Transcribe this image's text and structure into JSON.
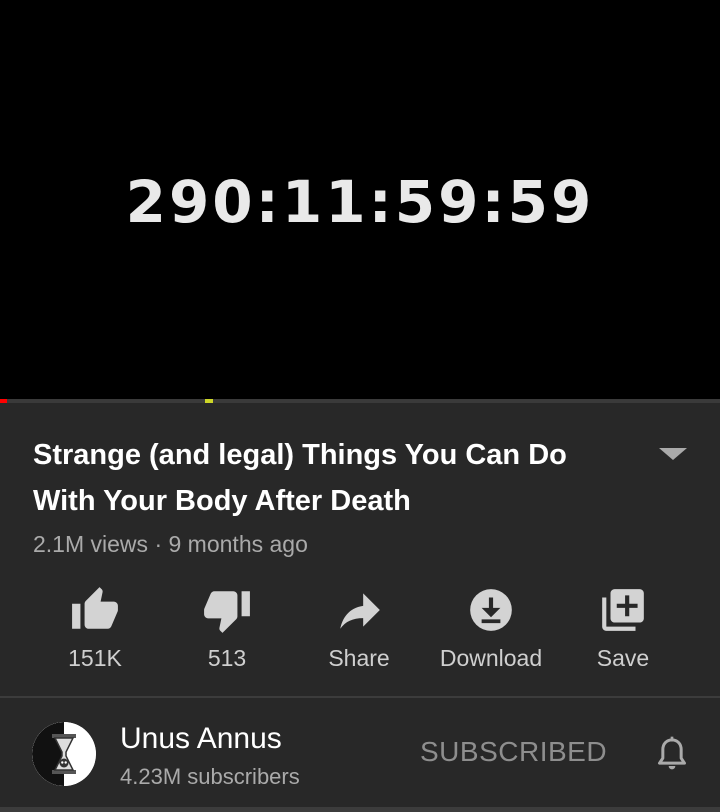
{
  "player": {
    "timer": "290:11:59:59",
    "progress_played": 0.01,
    "ad_marker_position": 0.285
  },
  "video": {
    "title": "Strange (and legal) Things You Can Do With Your Body After Death",
    "views": "2.1M views",
    "separator": "·",
    "age": "9 months ago"
  },
  "actions": [
    {
      "label": "151K",
      "icon": "thumb-up-icon"
    },
    {
      "label": "513",
      "icon": "thumb-down-icon"
    },
    {
      "label": "Share",
      "icon": "share-icon"
    },
    {
      "label": "Download",
      "icon": "download-icon"
    },
    {
      "label": "Save",
      "icon": "playlist-add-icon"
    }
  ],
  "channel": {
    "name": "Unus Annus",
    "subscribers": "4.23M subscribers",
    "subscribe_state": "SUBSCRIBED",
    "avatar_icon": "hourglass-skull-icon",
    "bell_icon": "bell-icon"
  },
  "colors": {
    "background": "#282828",
    "player_background": "#000000",
    "progress_played": "#ff0000",
    "ad_marker": "#cdd628",
    "secondary_text": "#aaaaaa"
  }
}
